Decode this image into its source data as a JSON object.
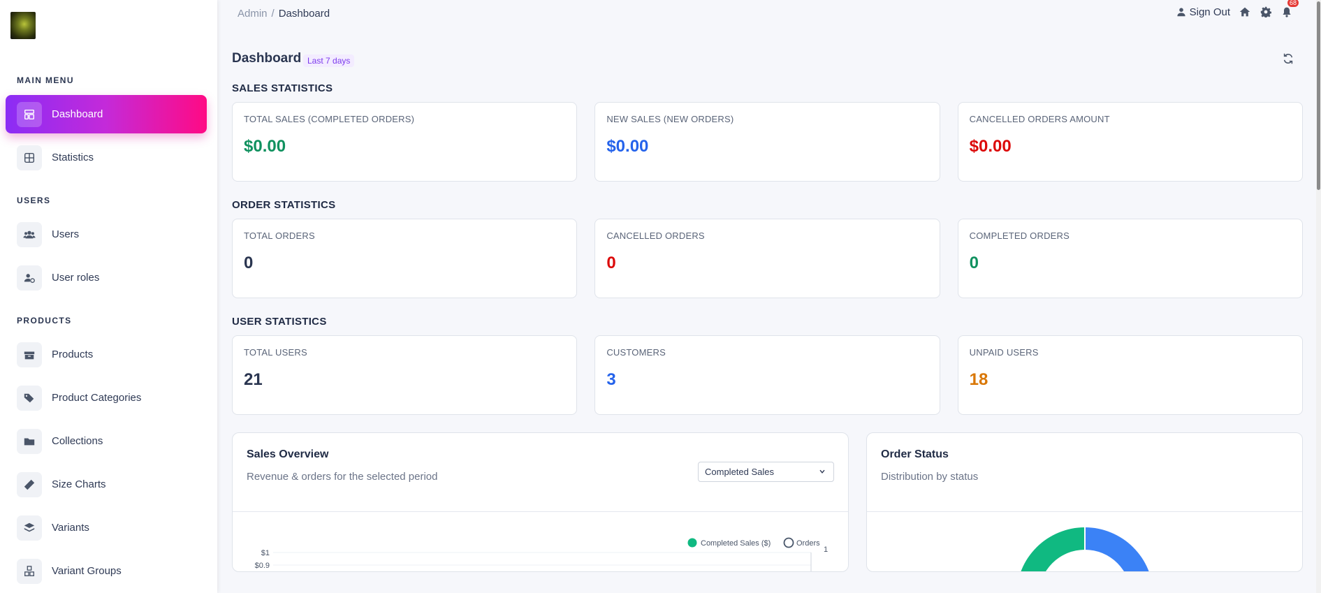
{
  "sidebar": {
    "sections": {
      "main": "MAIN MENU",
      "users": "USERS",
      "products": "PRODUCTS"
    },
    "items": [
      {
        "label": "Dashboard",
        "icon": "dashboard-icon",
        "active": true
      },
      {
        "label": "Statistics",
        "icon": "statistics-icon"
      },
      {
        "label": "Users",
        "icon": "users-icon"
      },
      {
        "label": "User roles",
        "icon": "user-roles-icon"
      },
      {
        "label": "Products",
        "icon": "products-icon"
      },
      {
        "label": "Product Categories",
        "icon": "tags-icon"
      },
      {
        "label": "Collections",
        "icon": "folder-icon"
      },
      {
        "label": "Size Charts",
        "icon": "ruler-icon"
      },
      {
        "label": "Variants",
        "icon": "layers-icon"
      },
      {
        "label": "Variant Groups",
        "icon": "cubes-icon"
      }
    ]
  },
  "header": {
    "breadcrumb": {
      "root": "Admin",
      "separator": "/",
      "current": "Dashboard"
    },
    "sign_out": "Sign Out",
    "notification_count": "68"
  },
  "page": {
    "title": "Dashboard",
    "period": "Last 7 days"
  },
  "sales_statistics": {
    "title": "SALES STATISTICS",
    "cards": [
      {
        "label": "TOTAL SALES (COMPLETED ORDERS)",
        "value": "$0.00",
        "color": "#10915f"
      },
      {
        "label": "NEW SALES (NEW ORDERS)",
        "value": "$0.00",
        "color": "#2563eb"
      },
      {
        "label": "CANCELLED ORDERS AMOUNT",
        "value": "$0.00",
        "color": "#dc0a0a"
      }
    ]
  },
  "order_statistics": {
    "title": "ORDER STATISTICS",
    "cards": [
      {
        "label": "TOTAL ORDERS",
        "value": "0",
        "color": "#2a3550"
      },
      {
        "label": "CANCELLED ORDERS",
        "value": "0",
        "color": "#dc0a0a"
      },
      {
        "label": "COMPLETED ORDERS",
        "value": "0",
        "color": "#10915f"
      }
    ]
  },
  "user_statistics": {
    "title": "USER STATISTICS",
    "cards": [
      {
        "label": "TOTAL USERS",
        "value": "21",
        "color": "#2a3550"
      },
      {
        "label": "CUSTOMERS",
        "value": "3",
        "color": "#2563eb"
      },
      {
        "label": "UNPAID USERS",
        "value": "18",
        "color": "#d97706"
      }
    ]
  },
  "sales_overview": {
    "title": "Sales Overview",
    "subtitle": "Revenue & orders for the selected period",
    "select_value": "Completed Sales",
    "legend": [
      {
        "name": "Completed Sales ($)",
        "color": "#10b981"
      },
      {
        "name": "Orders",
        "color": "#475569"
      }
    ],
    "y_ticks_left": [
      "$1",
      "$0.9"
    ],
    "y_ticks_right": [
      "1"
    ]
  },
  "order_status": {
    "title": "Order Status",
    "subtitle": "Distribution by status"
  },
  "colors": {
    "accent_gradient_start": "#8b2cf5",
    "accent_gradient_end": "#ff0a84",
    "donut_green": "#10b981",
    "donut_blue": "#3b82f6"
  }
}
